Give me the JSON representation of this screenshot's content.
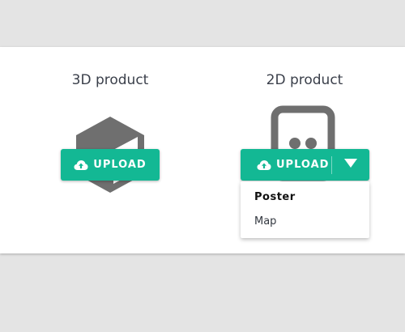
{
  "products": {
    "product_3d": {
      "title": "3D product",
      "upload_label": "UPLOAD",
      "icon": "cube-icon"
    },
    "product_2d": {
      "title": "2D product",
      "upload_label": "UPLOAD",
      "icon": "card-icon",
      "menu": [
        {
          "label": "Poster",
          "selected": true
        },
        {
          "label": "Map",
          "selected": false
        }
      ]
    }
  },
  "colors": {
    "accent": "#13b894",
    "icon": "#6f6f6f",
    "background": "#e4e4e4",
    "panel": "#ffffff"
  }
}
